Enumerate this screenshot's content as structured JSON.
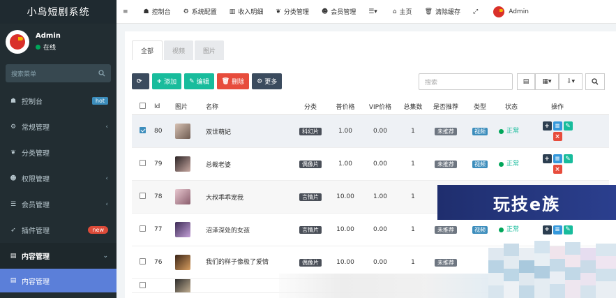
{
  "sidebar": {
    "brand": "小鸟短剧系统",
    "user": {
      "name": "Admin",
      "status": "在线"
    },
    "search_placeholder": "搜索菜单",
    "items": [
      {
        "icon": "dashboard-icon",
        "glyph": "☗",
        "label": "控制台",
        "badge": "hot"
      },
      {
        "icon": "cogs-icon",
        "glyph": "⚙",
        "label": "常规管理",
        "chevron": "‹"
      },
      {
        "icon": "leaf-icon",
        "glyph": "❦",
        "label": "分类管理"
      },
      {
        "icon": "group-icon",
        "glyph": "☻",
        "label": "权限管理",
        "chevron": "‹"
      },
      {
        "icon": "list-icon",
        "glyph": "☰",
        "label": "会员管理",
        "chevron": "‹"
      },
      {
        "icon": "rocket-icon",
        "glyph": "➶",
        "label": "插件管理",
        "badge": "new"
      },
      {
        "icon": "file-icon",
        "glyph": "▤",
        "label": "内容管理",
        "chevron": "⌄"
      },
      {
        "icon": "file-icon",
        "glyph": "▤",
        "label": "内容管理"
      }
    ]
  },
  "topbar": {
    "items": [
      {
        "glyph": "≡",
        "label": ""
      },
      {
        "glyph": "☗",
        "label": "控制台"
      },
      {
        "glyph": "⚙",
        "label": "系统配置"
      },
      {
        "glyph": "▥",
        "label": "收入明细"
      },
      {
        "glyph": "❦",
        "label": "分类管理"
      },
      {
        "glyph": "☻",
        "label": "会员管理"
      },
      {
        "glyph": "☰▾",
        "label": ""
      },
      {
        "glyph": "⌂",
        "label": "主页"
      },
      {
        "glyph": "🗑",
        "label": "清除缓存"
      },
      {
        "glyph": "⤢",
        "label": ""
      }
    ],
    "user": "Admin"
  },
  "tabs": [
    "全部",
    "视频",
    "图片"
  ],
  "toolbar": {
    "refresh": "⟳",
    "add": "添加",
    "edit": "编辑",
    "delete": "删除",
    "more": "更多"
  },
  "search": {
    "placeholder": "搜索"
  },
  "table": {
    "headers": [
      "Id",
      "图片",
      "名称",
      "分类",
      "普价格",
      "VIP价格",
      "总集数",
      "是否推荐",
      "类型",
      "状态",
      "操作"
    ],
    "rows": [
      {
        "checked": true,
        "id": "80",
        "name": "双世萌妃",
        "category": "科幻片",
        "price": "1.00",
        "vip": "0.00",
        "episodes": "1",
        "recommend": "未推荐",
        "type": "视频",
        "status": "正常"
      },
      {
        "checked": false,
        "id": "79",
        "name": "总裁老婆",
        "category": "偶像片",
        "price": "1.00",
        "vip": "0.00",
        "episodes": "1",
        "recommend": "未推荐",
        "type": "视频",
        "status": "正常"
      },
      {
        "checked": false,
        "id": "78",
        "name": "大叔乖乖宠我",
        "category": "言情片",
        "price": "10.00",
        "vip": "1.00",
        "episodes": "1",
        "recommend": "",
        "type": "",
        "status": ""
      },
      {
        "checked": false,
        "id": "77",
        "name": "沼泽深处的女孩",
        "category": "言情片",
        "price": "10.00",
        "vip": "0.00",
        "episodes": "1",
        "recommend": "未推荐",
        "type": "视频",
        "status": "正常"
      },
      {
        "checked": false,
        "id": "76",
        "name": "我们的样子像极了爱情",
        "category": "偶像片",
        "price": "10.00",
        "vip": "0.00",
        "episodes": "1",
        "recommend": "未推荐",
        "type": "",
        "status": ""
      }
    ]
  },
  "watermark": "玩技e族"
}
